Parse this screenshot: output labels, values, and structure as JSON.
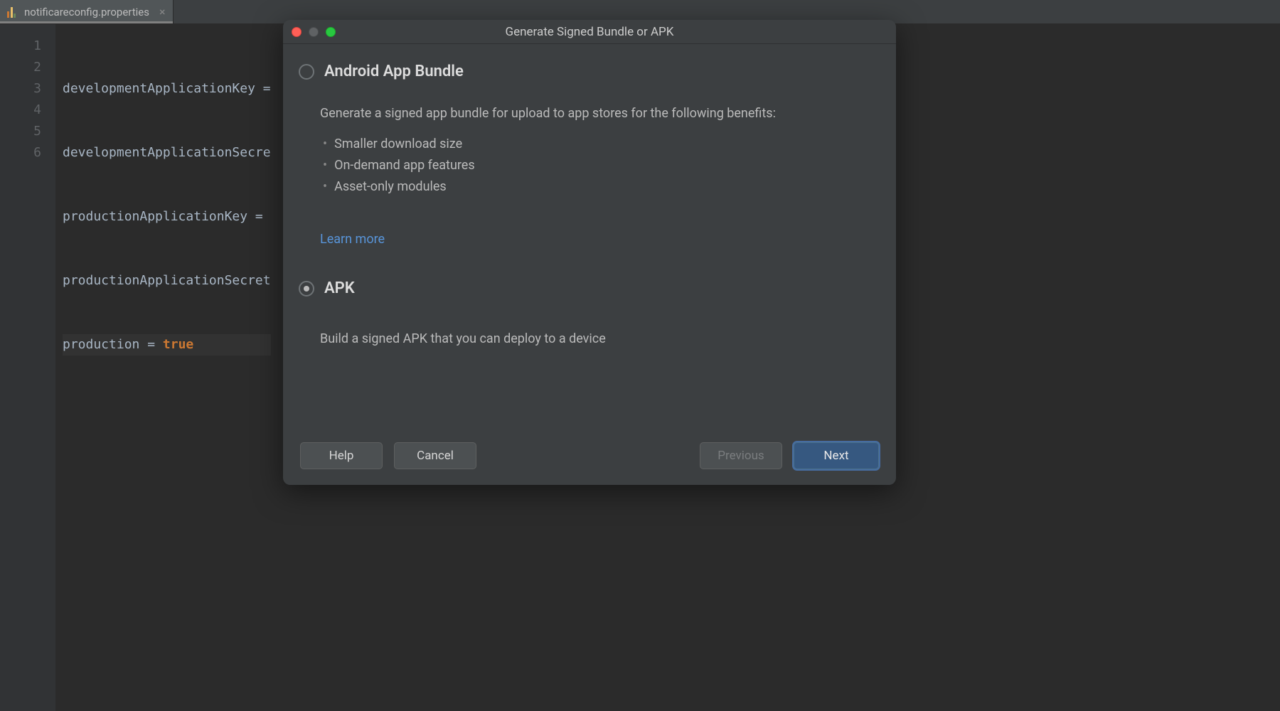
{
  "tab": {
    "filename": "notificareconfig.properties",
    "close_glyph": "×"
  },
  "editor": {
    "line_numbers": [
      "1",
      "2",
      "3",
      "4",
      "5",
      "6"
    ],
    "lines": {
      "l1_key": "developmentApplicationKey =",
      "l2_key": "developmentApplicationSecre",
      "l3_key": "productionApplicationKey =",
      "l4_key": "productionApplicationSecret",
      "l5_key": "production = ",
      "l5_val": "true",
      "l6": ""
    }
  },
  "dialog": {
    "title": "Generate Signed Bundle or APK",
    "option_bundle": {
      "label": "Android App Bundle",
      "selected": false,
      "description": "Generate a signed app bundle for upload to app stores for the following benefits:",
      "benefits": [
        "Smaller download size",
        "On-demand app features",
        "Asset-only modules"
      ],
      "learn_more": "Learn more"
    },
    "option_apk": {
      "label": "APK",
      "selected": true,
      "description": "Build a signed APK that you can deploy to a device"
    },
    "buttons": {
      "help": "Help",
      "cancel": "Cancel",
      "previous": "Previous",
      "next": "Next"
    }
  }
}
